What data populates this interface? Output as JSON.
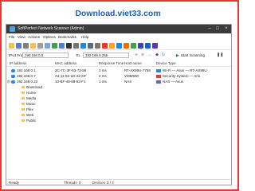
{
  "watermark": "Download.viet33.com",
  "window": {
    "title": "SoftPerfect Network Scanner (Admin)"
  },
  "menu": [
    "File",
    "View",
    "Actions",
    "Options",
    "Bookmarks",
    "Help"
  ],
  "range": {
    "from_label": "IPv4 From",
    "from_value": "192.168.0.0",
    "to_label": "To",
    "to_value": "192.168.0.255",
    "start_label": "Start Scanning"
  },
  "columns": {
    "ip": "IP address",
    "mac": "MAC address",
    "response": "Response Time",
    "host": "Host name",
    "device": "Device Type"
  },
  "hosts": [
    {
      "ip": "192.168.0.1",
      "mac": "3C-7C-3F-53-73-58",
      "response": "2 ms",
      "host": "RT-AX86U-7758",
      "device": "Wi-Fi — Asus — RT-AX86U",
      "device_color": "#1e88e5"
    },
    {
      "ip": "192.168.0.7",
      "mac": "A4-11-62-1D-22-DF",
      "response": "2 ms",
      "host": "VMM500",
      "device": "Security System — Arlo",
      "device_color": "#e53935"
    },
    {
      "ip": "192.168.0.22",
      "mac": "10-BF-48-88-53-F1",
      "response": "1 ms",
      "host": "NAS",
      "device": "NAS — Asus",
      "device_color": "#5c6bc0"
    }
  ],
  "shares": [
    "Download",
    "Home",
    "Media",
    "Music",
    "Plex",
    "Web",
    "Public"
  ],
  "status": {
    "state": "Ready",
    "threads_label": "Threads",
    "threads_value": "0",
    "devices_label": "Devices",
    "devices_value": "3 / 3"
  }
}
